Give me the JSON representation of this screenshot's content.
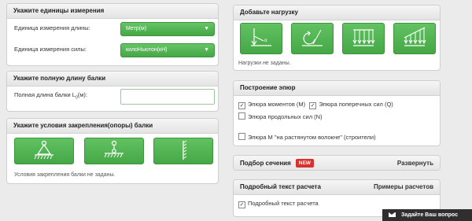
{
  "units": {
    "title": "Укажите единицы измерения",
    "length_label": "Единица измерения длины:",
    "length_value": "Метр(м)",
    "force_label": "Единица измерения силы:",
    "force_value": "килоНьютон(кН)"
  },
  "beam_length": {
    "title": "Укажите полную длину балки",
    "label": "Полная длина балки L",
    "label_sub": "0",
    "label_suffix": "(м):",
    "value": ""
  },
  "supports": {
    "title": "Укажите условия закрепления(опоры) балки",
    "buttons": [
      "pinned-support-icon",
      "roller-support-icon",
      "fixed-support-icon"
    ],
    "note": "Условия закрепления балки не заданы."
  },
  "loads": {
    "title": "Добавьте нагрузку",
    "buttons": [
      "point-force-icon",
      "moment-icon",
      "uniform-load-icon",
      "linear-load-icon"
    ],
    "note": "Нагрузки не заданы."
  },
  "diagrams": {
    "title": "Построение эпюр",
    "moments": {
      "label": "Эпюра моментов (М)",
      "checked": true
    },
    "shear": {
      "label": "Эпюра поперечных сил (Q)",
      "checked": true
    },
    "axial": {
      "label": "Эпюра продольных сил (N)",
      "checked": false
    },
    "tension_side": {
      "label": "Эпюра М \"на растянутом волокне\" (строители)",
      "checked": false
    }
  },
  "section": {
    "title": "Подбор сечения",
    "badge": "NEW",
    "expand": "Развернуть"
  },
  "report": {
    "title": "Подробный текст расчета",
    "examples": "Примеры расчетов",
    "checkbox_label": "Подробный текст расчета",
    "checked": true
  },
  "feedback": {
    "label": "Задайте Ваш вопрос"
  },
  "colors": {
    "accent_green": "#4cae4c",
    "badge_red": "#d9312b"
  }
}
